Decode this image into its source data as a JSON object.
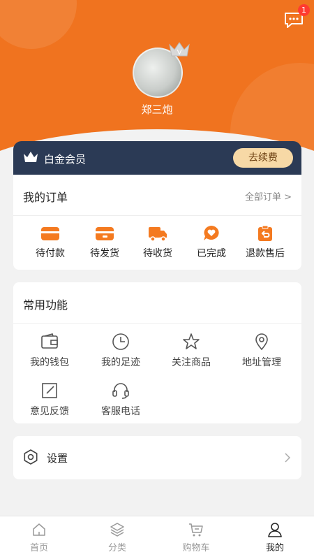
{
  "header": {
    "username": "郑三炮",
    "message_badge": "1",
    "vip_badge_letter": "V"
  },
  "vip": {
    "label": "白金会员",
    "renew_button": "去续费"
  },
  "orders": {
    "title": "我的订单",
    "all_link": "全部订单 >",
    "items": [
      {
        "label": "待付款",
        "icon": "wallet-card-icon"
      },
      {
        "label": "待发货",
        "icon": "package-box-icon"
      },
      {
        "label": "待收货",
        "icon": "delivery-truck-icon"
      },
      {
        "label": "已完成",
        "icon": "heart-chat-icon"
      },
      {
        "label": "退款售后",
        "icon": "refund-clipboard-icon"
      }
    ]
  },
  "functions": {
    "title": "常用功能",
    "items": [
      {
        "label": "我的钱包",
        "icon": "wallet-icon"
      },
      {
        "label": "我的足迹",
        "icon": "clock-icon"
      },
      {
        "label": "关注商品",
        "icon": "star-icon"
      },
      {
        "label": "地址管理",
        "icon": "location-pin-icon"
      },
      {
        "label": "意见反馈",
        "icon": "edit-icon"
      },
      {
        "label": "客服电话",
        "icon": "headset-icon"
      }
    ]
  },
  "settings": {
    "label": "设置"
  },
  "tabbar": {
    "items": [
      {
        "label": "首页",
        "icon": "home-icon"
      },
      {
        "label": "分类",
        "icon": "layers-icon"
      },
      {
        "label": "购物车",
        "icon": "cart-icon"
      },
      {
        "label": "我的",
        "icon": "user-icon",
        "active": true
      }
    ]
  },
  "colors": {
    "header_orange": "#f0731f",
    "vip_navy": "#2b3a55",
    "renew_gold": "#f7d9a6",
    "order_icon_orange": "#f47a20",
    "badge_red": "#ff3b30"
  }
}
